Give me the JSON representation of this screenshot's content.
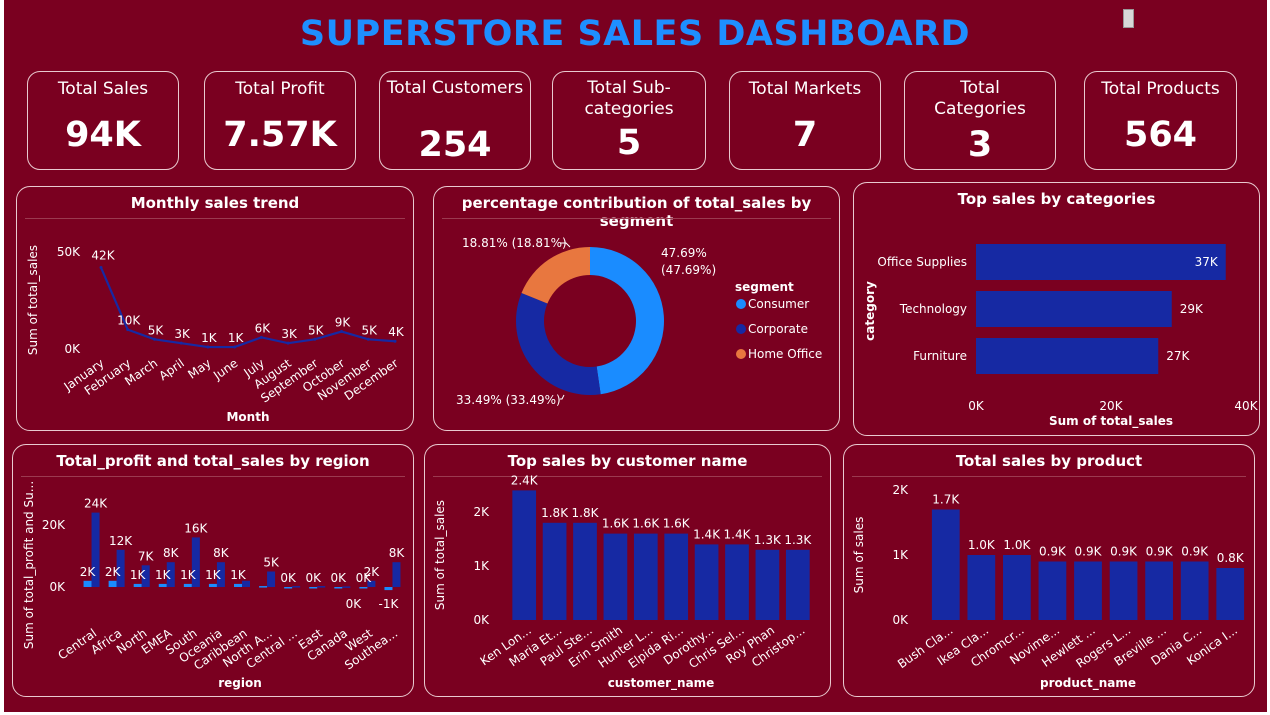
{
  "title": "SUPERSTORE SALES DASHBOARD",
  "colors": {
    "background": "#7a0020",
    "title": "#1e8fff",
    "bar": "#1629a3",
    "bar_light": "#1a8cff",
    "line": "#1629a3",
    "consumer": "#1a8cff",
    "corporate": "#1629a3",
    "home_office": "#e8773f"
  },
  "kpis": [
    {
      "label": "Total Sales",
      "value": "94K"
    },
    {
      "label": "Total Profit",
      "value": "7.57K"
    },
    {
      "label": "Total Customers",
      "value": "254"
    },
    {
      "label": "Total Sub-categories",
      "value": "5"
    },
    {
      "label": "Total Markets",
      "value": "7"
    },
    {
      "label": "Total Categories",
      "value": "3"
    },
    {
      "label": "Total Products",
      "value": "564"
    }
  ],
  "panels": {
    "monthly": {
      "title": "Monthly sales trend"
    },
    "segment": {
      "title": "percentage contribution of total_sales by segment"
    },
    "categories": {
      "title": "Top sales by categories"
    },
    "region": {
      "title": "Total_profit and total_sales by region"
    },
    "customer": {
      "title": "Top sales by customer name"
    },
    "product": {
      "title": "Total sales by product"
    }
  },
  "chart_data": [
    {
      "type": "line",
      "title": "Monthly sales trend",
      "xlabel": "Month",
      "ylabel": "Sum of total_sales",
      "ylim": [
        0,
        50000
      ],
      "y_ticks": [
        "50K",
        "0K"
      ],
      "categories": [
        "January",
        "February",
        "March",
        "April",
        "May",
        "June",
        "July",
        "August",
        "September",
        "October",
        "November",
        "December"
      ],
      "values": [
        42000,
        10000,
        5000,
        3000,
        1000,
        1000,
        6000,
        3000,
        5000,
        9000,
        5000,
        4000
      ],
      "data_labels": [
        "42K",
        "10K",
        "5K",
        "3K",
        "1K",
        "1K",
        "6K",
        "3K",
        "5K",
        "9K",
        "5K",
        "4K"
      ]
    },
    {
      "type": "pie",
      "title": "percentage contribution of total_sales by segment",
      "legend_title": "segment",
      "legend_position": "right",
      "series": [
        {
          "name": "Consumer",
          "value": 47.69,
          "label": "47.69% (47.69%)"
        },
        {
          "name": "Corporate",
          "value": 33.49,
          "label": "33.49% (33.49%)"
        },
        {
          "name": "Home Office",
          "value": 18.81,
          "label": "18.81% (18.81%)"
        }
      ]
    },
    {
      "type": "bar",
      "orientation": "horizontal",
      "title": "Top sales by categories",
      "xlabel": "Sum of total_sales",
      "ylabel": "category",
      "xlim": [
        0,
        40000
      ],
      "x_ticks": [
        "0K",
        "20K",
        "40K"
      ],
      "categories": [
        "Office Supplies",
        "Technology",
        "Furniture"
      ],
      "values": [
        37000,
        29000,
        27000
      ],
      "data_labels": [
        "37K",
        "29K",
        "27K"
      ]
    },
    {
      "type": "bar",
      "title": "Total_profit and total_sales by region",
      "xlabel": "region",
      "ylabel": "Sum of total_profit and Su...",
      "ylim": [
        -2000,
        27000
      ],
      "y_ticks": [
        "20K",
        "0K"
      ],
      "categories": [
        "Central",
        "Africa",
        "North",
        "EMEA",
        "South",
        "Oceania",
        "Caribbean",
        "North A...",
        "Central ...",
        "East",
        "Canada",
        "West",
        "Southea..."
      ],
      "series": [
        {
          "name": "total_profit",
          "values": [
            2000,
            2000,
            1000,
            1000,
            1000,
            1000,
            1000,
            300,
            0,
            0,
            0,
            0,
            -1000
          ],
          "data_labels": [
            "2K",
            "2K",
            "1K",
            "1K",
            "1K",
            "1K",
            "1K",
            "",
            "0K",
            "0K",
            "0K",
            "0K",
            "-1K"
          ]
        },
        {
          "name": "total_sales",
          "values": [
            24000,
            12000,
            7000,
            8000,
            16000,
            8000,
            2000,
            5000,
            300,
            300,
            200,
            2000,
            8000
          ],
          "data_labels": [
            "24K",
            "12K",
            "7K",
            "8K",
            "16K",
            "8K",
            "",
            "5K",
            "",
            "",
            "",
            "2K",
            "8K"
          ]
        }
      ],
      "extra_labels": [
        "0K"
      ]
    },
    {
      "type": "bar",
      "title": "Top sales by customer name",
      "xlabel": "customer_name",
      "ylabel": "Sum of total_sales",
      "ylim": [
        0,
        2500
      ],
      "y_ticks": [
        "2K",
        "1K",
        "0K"
      ],
      "categories": [
        "Ken Lon...",
        "Maria Et...",
        "Paul Ste...",
        "Erin Smith",
        "Hunter L...",
        "Elpida Ri...",
        "Dorothy...",
        "Chris Sel...",
        "Roy Phan",
        "Christop..."
      ],
      "values": [
        2400,
        1800,
        1800,
        1600,
        1600,
        1600,
        1400,
        1400,
        1300,
        1300
      ],
      "data_labels": [
        "2.4K",
        "1.8K",
        "1.8K",
        "1.6K",
        "1.6K",
        "1.6K",
        "1.4K",
        "1.4K",
        "1.3K",
        "1.3K"
      ]
    },
    {
      "type": "bar",
      "title": "Total sales by product",
      "xlabel": "product_name",
      "ylabel": "Sum of sales",
      "ylim": [
        0,
        2000
      ],
      "y_ticks": [
        "2K",
        "1K",
        "0K"
      ],
      "categories": [
        "Bush Cla...",
        "Ikea Cla...",
        "Chromcr...",
        "Novime...",
        "Hewlett ...",
        "Rogers L...",
        "Breville ...",
        "Dania C...",
        "Konica I..."
      ],
      "values": [
        1700,
        1000,
        1000,
        900,
        900,
        900,
        900,
        900,
        800
      ],
      "data_labels": [
        "1.7K",
        "1.0K",
        "1.0K",
        "0.9K",
        "0.9K",
        "0.9K",
        "0.9K",
        "0.9K",
        "0.8K"
      ]
    }
  ]
}
